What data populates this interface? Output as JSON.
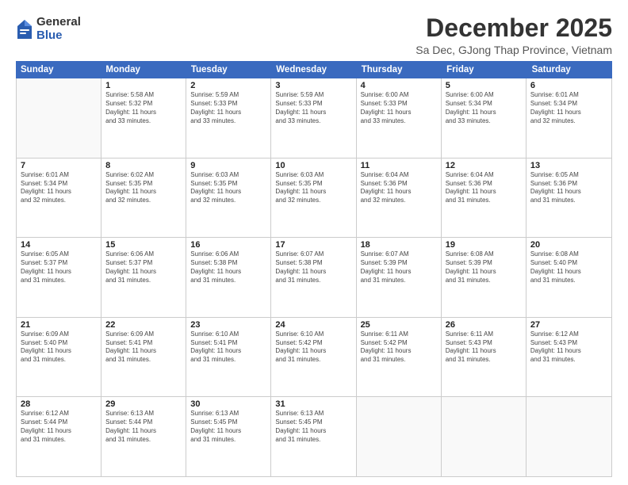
{
  "logo": {
    "general": "General",
    "blue": "Blue"
  },
  "title": "December 2025",
  "subtitle": "Sa Dec, GJong Thap Province, Vietnam",
  "header_days": [
    "Sunday",
    "Monday",
    "Tuesday",
    "Wednesday",
    "Thursday",
    "Friday",
    "Saturday"
  ],
  "weeks": [
    [
      {
        "day": "",
        "lines": []
      },
      {
        "day": "1",
        "lines": [
          "Sunrise: 5:58 AM",
          "Sunset: 5:32 PM",
          "Daylight: 11 hours",
          "and 33 minutes."
        ]
      },
      {
        "day": "2",
        "lines": [
          "Sunrise: 5:59 AM",
          "Sunset: 5:33 PM",
          "Daylight: 11 hours",
          "and 33 minutes."
        ]
      },
      {
        "day": "3",
        "lines": [
          "Sunrise: 5:59 AM",
          "Sunset: 5:33 PM",
          "Daylight: 11 hours",
          "and 33 minutes."
        ]
      },
      {
        "day": "4",
        "lines": [
          "Sunrise: 6:00 AM",
          "Sunset: 5:33 PM",
          "Daylight: 11 hours",
          "and 33 minutes."
        ]
      },
      {
        "day": "5",
        "lines": [
          "Sunrise: 6:00 AM",
          "Sunset: 5:34 PM",
          "Daylight: 11 hours",
          "and 33 minutes."
        ]
      },
      {
        "day": "6",
        "lines": [
          "Sunrise: 6:01 AM",
          "Sunset: 5:34 PM",
          "Daylight: 11 hours",
          "and 32 minutes."
        ]
      }
    ],
    [
      {
        "day": "7",
        "lines": [
          "Sunrise: 6:01 AM",
          "Sunset: 5:34 PM",
          "Daylight: 11 hours",
          "and 32 minutes."
        ]
      },
      {
        "day": "8",
        "lines": [
          "Sunrise: 6:02 AM",
          "Sunset: 5:35 PM",
          "Daylight: 11 hours",
          "and 32 minutes."
        ]
      },
      {
        "day": "9",
        "lines": [
          "Sunrise: 6:03 AM",
          "Sunset: 5:35 PM",
          "Daylight: 11 hours",
          "and 32 minutes."
        ]
      },
      {
        "day": "10",
        "lines": [
          "Sunrise: 6:03 AM",
          "Sunset: 5:35 PM",
          "Daylight: 11 hours",
          "and 32 minutes."
        ]
      },
      {
        "day": "11",
        "lines": [
          "Sunrise: 6:04 AM",
          "Sunset: 5:36 PM",
          "Daylight: 11 hours",
          "and 32 minutes."
        ]
      },
      {
        "day": "12",
        "lines": [
          "Sunrise: 6:04 AM",
          "Sunset: 5:36 PM",
          "Daylight: 11 hours",
          "and 31 minutes."
        ]
      },
      {
        "day": "13",
        "lines": [
          "Sunrise: 6:05 AM",
          "Sunset: 5:36 PM",
          "Daylight: 11 hours",
          "and 31 minutes."
        ]
      }
    ],
    [
      {
        "day": "14",
        "lines": [
          "Sunrise: 6:05 AM",
          "Sunset: 5:37 PM",
          "Daylight: 11 hours",
          "and 31 minutes."
        ]
      },
      {
        "day": "15",
        "lines": [
          "Sunrise: 6:06 AM",
          "Sunset: 5:37 PM",
          "Daylight: 11 hours",
          "and 31 minutes."
        ]
      },
      {
        "day": "16",
        "lines": [
          "Sunrise: 6:06 AM",
          "Sunset: 5:38 PM",
          "Daylight: 11 hours",
          "and 31 minutes."
        ]
      },
      {
        "day": "17",
        "lines": [
          "Sunrise: 6:07 AM",
          "Sunset: 5:38 PM",
          "Daylight: 11 hours",
          "and 31 minutes."
        ]
      },
      {
        "day": "18",
        "lines": [
          "Sunrise: 6:07 AM",
          "Sunset: 5:39 PM",
          "Daylight: 11 hours",
          "and 31 minutes."
        ]
      },
      {
        "day": "19",
        "lines": [
          "Sunrise: 6:08 AM",
          "Sunset: 5:39 PM",
          "Daylight: 11 hours",
          "and 31 minutes."
        ]
      },
      {
        "day": "20",
        "lines": [
          "Sunrise: 6:08 AM",
          "Sunset: 5:40 PM",
          "Daylight: 11 hours",
          "and 31 minutes."
        ]
      }
    ],
    [
      {
        "day": "21",
        "lines": [
          "Sunrise: 6:09 AM",
          "Sunset: 5:40 PM",
          "Daylight: 11 hours",
          "and 31 minutes."
        ]
      },
      {
        "day": "22",
        "lines": [
          "Sunrise: 6:09 AM",
          "Sunset: 5:41 PM",
          "Daylight: 11 hours",
          "and 31 minutes."
        ]
      },
      {
        "day": "23",
        "lines": [
          "Sunrise: 6:10 AM",
          "Sunset: 5:41 PM",
          "Daylight: 11 hours",
          "and 31 minutes."
        ]
      },
      {
        "day": "24",
        "lines": [
          "Sunrise: 6:10 AM",
          "Sunset: 5:42 PM",
          "Daylight: 11 hours",
          "and 31 minutes."
        ]
      },
      {
        "day": "25",
        "lines": [
          "Sunrise: 6:11 AM",
          "Sunset: 5:42 PM",
          "Daylight: 11 hours",
          "and 31 minutes."
        ]
      },
      {
        "day": "26",
        "lines": [
          "Sunrise: 6:11 AM",
          "Sunset: 5:43 PM",
          "Daylight: 11 hours",
          "and 31 minutes."
        ]
      },
      {
        "day": "27",
        "lines": [
          "Sunrise: 6:12 AM",
          "Sunset: 5:43 PM",
          "Daylight: 11 hours",
          "and 31 minutes."
        ]
      }
    ],
    [
      {
        "day": "28",
        "lines": [
          "Sunrise: 6:12 AM",
          "Sunset: 5:44 PM",
          "Daylight: 11 hours",
          "and 31 minutes."
        ]
      },
      {
        "day": "29",
        "lines": [
          "Sunrise: 6:13 AM",
          "Sunset: 5:44 PM",
          "Daylight: 11 hours",
          "and 31 minutes."
        ]
      },
      {
        "day": "30",
        "lines": [
          "Sunrise: 6:13 AM",
          "Sunset: 5:45 PM",
          "Daylight: 11 hours",
          "and 31 minutes."
        ]
      },
      {
        "day": "31",
        "lines": [
          "Sunrise: 6:13 AM",
          "Sunset: 5:45 PM",
          "Daylight: 11 hours",
          "and 31 minutes."
        ]
      },
      {
        "day": "",
        "lines": []
      },
      {
        "day": "",
        "lines": []
      },
      {
        "day": "",
        "lines": []
      }
    ]
  ]
}
